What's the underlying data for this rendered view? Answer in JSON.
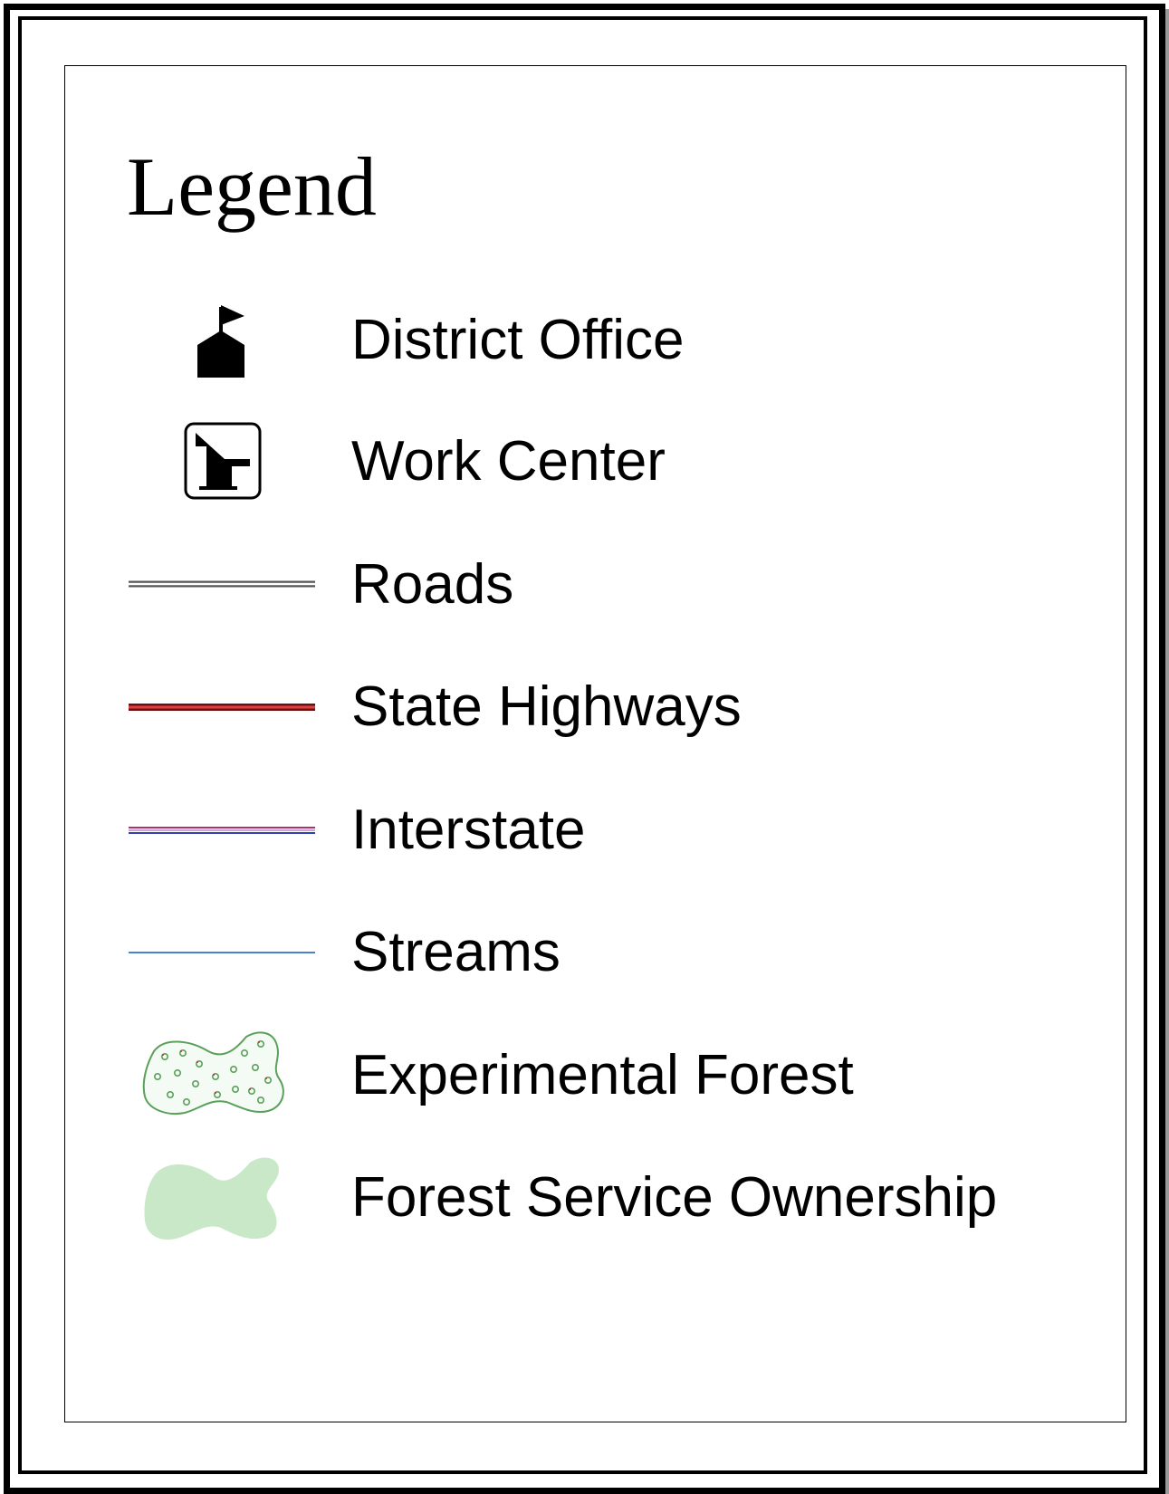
{
  "legend": {
    "title": "Legend",
    "items": [
      {
        "label": "District Office",
        "symbol": "district-office-icon"
      },
      {
        "label": "Work Center",
        "symbol": "work-center-icon"
      },
      {
        "label": "Roads",
        "symbol": "road-line",
        "color": "#555555"
      },
      {
        "label": "State Highways",
        "symbol": "state-highway-line",
        "color": "#b22222"
      },
      {
        "label": "Interstate",
        "symbol": "interstate-line",
        "color": "#b0306e"
      },
      {
        "label": "Streams",
        "symbol": "stream-line",
        "color": "#4a7fd4"
      },
      {
        "label": "Experimental Forest",
        "symbol": "experimental-forest-area",
        "color": "#4caf50"
      },
      {
        "label": "Forest Service Ownership",
        "symbol": "forest-service-area",
        "color": "#c8e8c8"
      }
    ]
  }
}
